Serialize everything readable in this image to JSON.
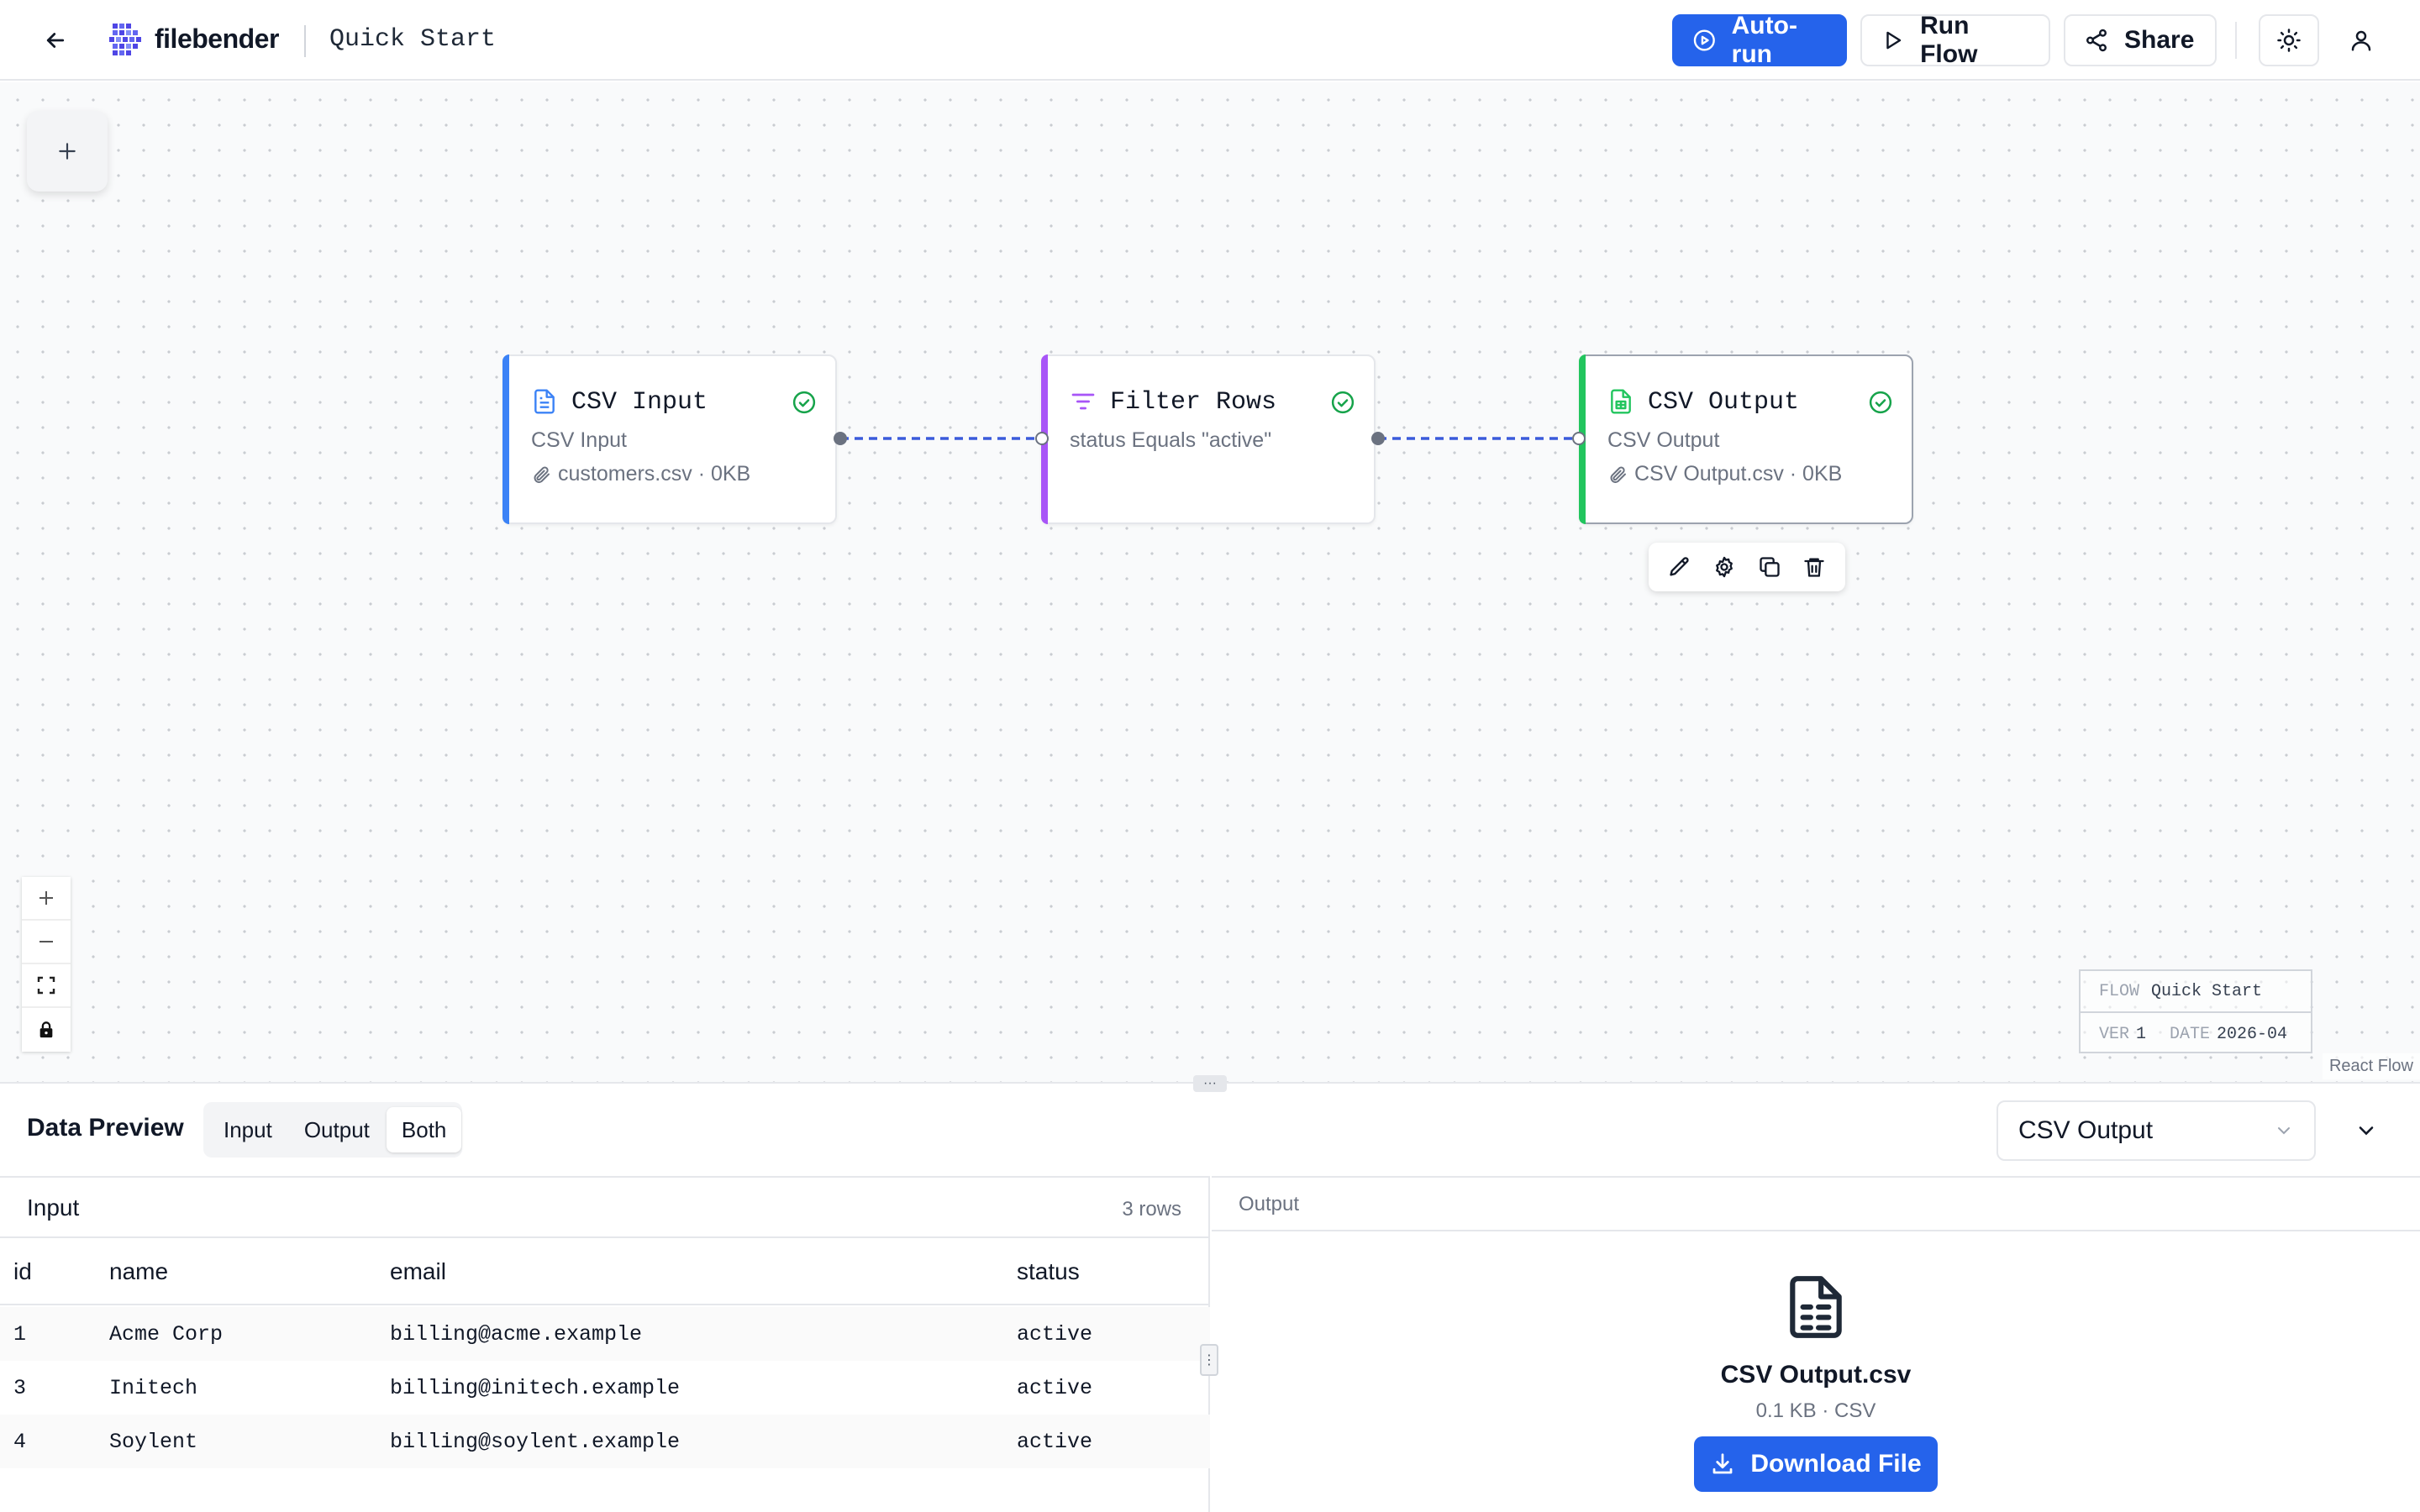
{
  "header": {
    "brand": "filebender",
    "flow_title": "Quick Start",
    "autorun_label": "Auto-run",
    "run_label": "Run Flow",
    "share_label": "Share"
  },
  "colors": {
    "accent": "#2563eb",
    "input_node": "#3b82f6",
    "filter_node": "#a855f7",
    "output_node": "#22c55e",
    "status_ok": "#16a34a"
  },
  "nodes": [
    {
      "title": "CSV Input",
      "subtitle": "CSV Input",
      "file": "customers.csv · 0KB",
      "icon": "file-text-icon",
      "status": "ok"
    },
    {
      "title": "Filter Rows",
      "subtitle": "status Equals \"active\"",
      "file": "",
      "icon": "filter-icon",
      "status": "ok"
    },
    {
      "title": "CSV Output",
      "subtitle": "CSV Output",
      "file": "CSV Output.csv · 0KB",
      "icon": "file-spreadsheet-icon",
      "status": "ok",
      "selected": true
    }
  ],
  "node_toolbar": [
    "edit-icon",
    "settings-icon",
    "duplicate-icon",
    "delete-icon"
  ],
  "flow_info": {
    "flow_label": "FLOW",
    "flow_value": "Quick Start",
    "ver_label": "VER",
    "ver_value": "1",
    "date_label": "DATE",
    "date_value": "2026-04"
  },
  "attribution": "React Flow",
  "preview": {
    "title": "Data Preview",
    "modes": [
      "Input",
      "Output",
      "Both"
    ],
    "active_mode": "Both",
    "selected_node": "CSV Output",
    "input": {
      "title": "Input",
      "row_count": "3 rows",
      "columns": [
        "id",
        "name",
        "email",
        "status"
      ],
      "rows": [
        [
          "1",
          "Acme Corp",
          "billing@acme.example",
          "active"
        ],
        [
          "3",
          "Initech",
          "billing@initech.example",
          "active"
        ],
        [
          "4",
          "Soylent",
          "billing@soylent.example",
          "active"
        ]
      ]
    },
    "output": {
      "title": "Output",
      "file_name": "CSV Output.csv",
      "file_meta": "0.1 KB · CSV",
      "download_label": "Download File"
    }
  }
}
